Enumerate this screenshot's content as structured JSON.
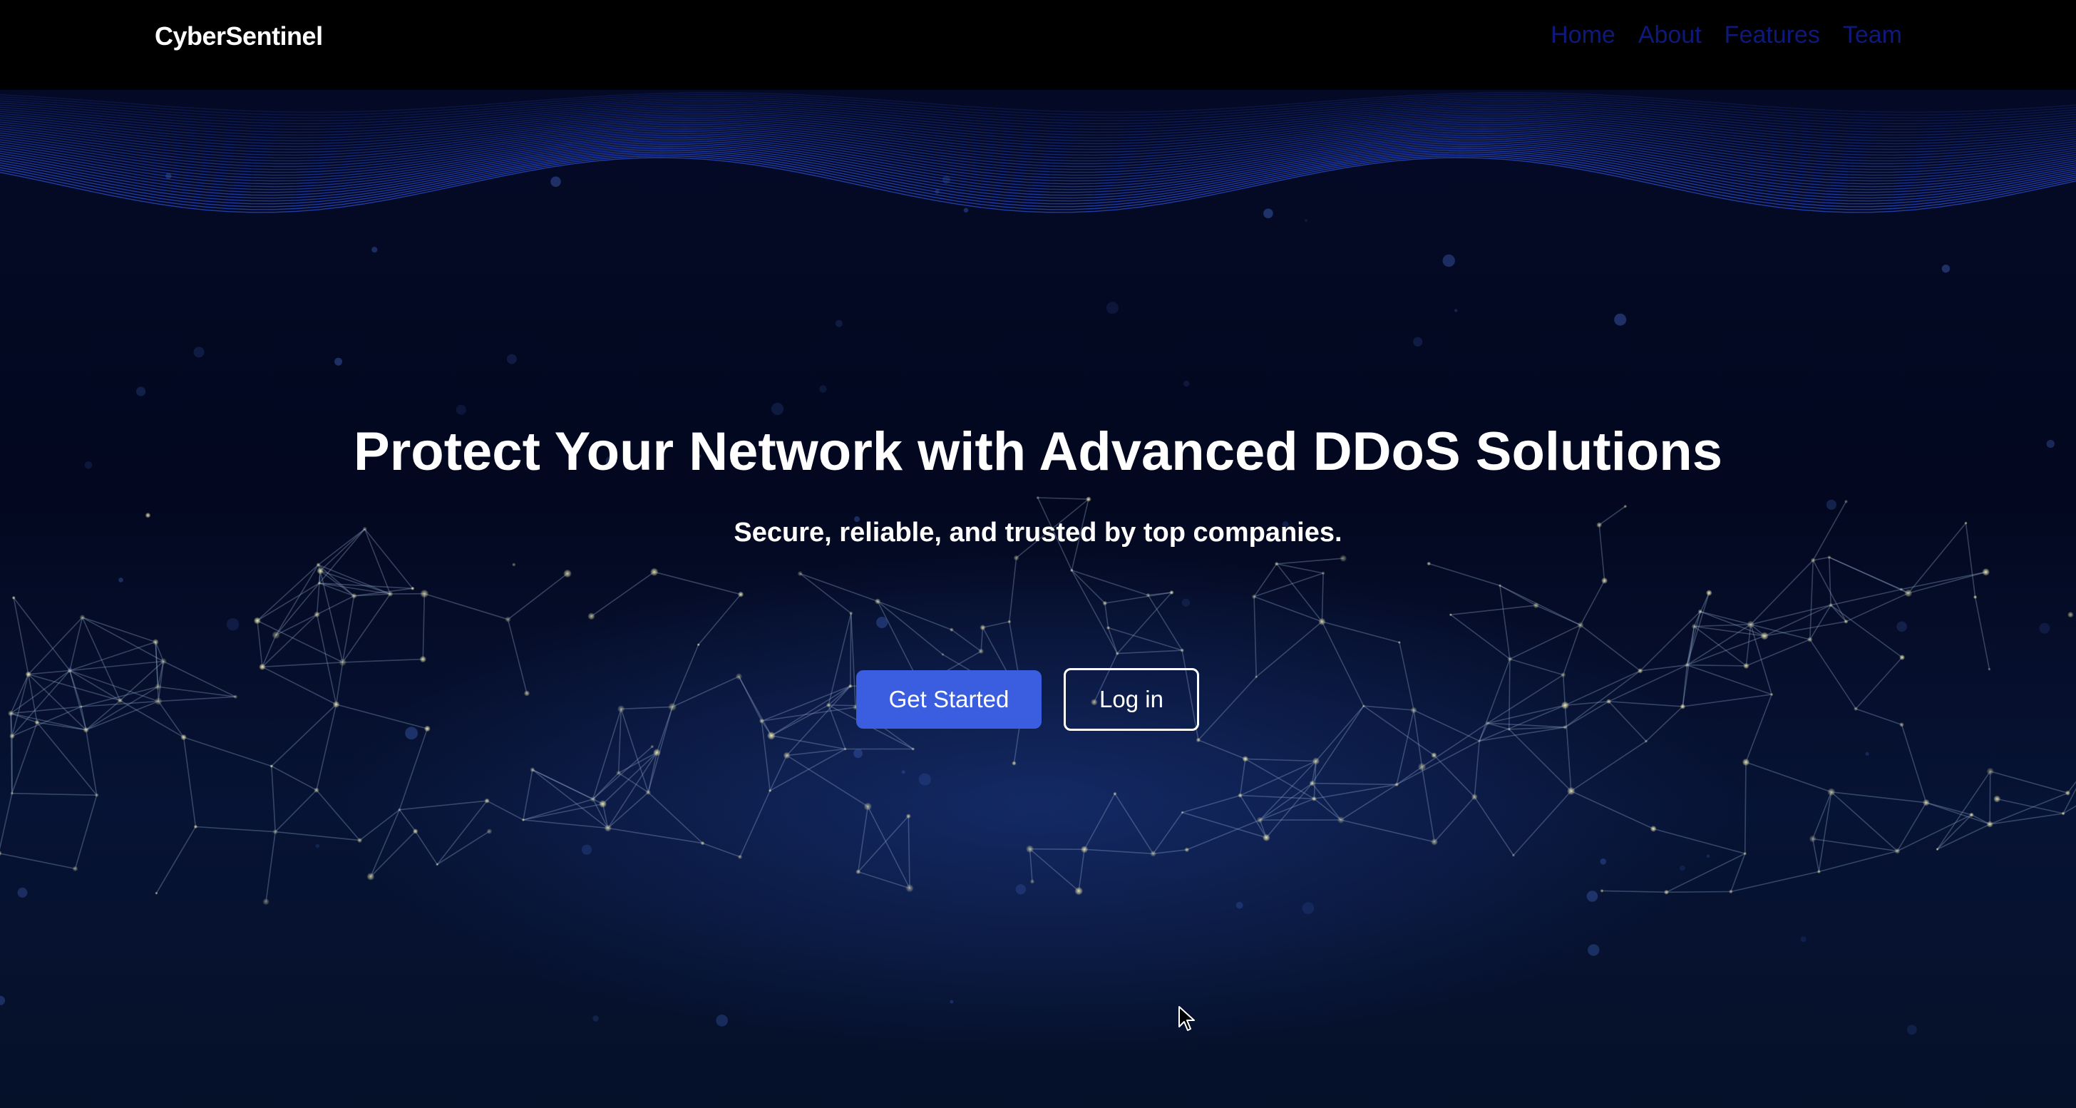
{
  "navbar": {
    "brand": "CyberSentinel",
    "links": [
      {
        "label": "Home"
      },
      {
        "label": "About"
      },
      {
        "label": "Features"
      },
      {
        "label": "Team"
      }
    ]
  },
  "hero": {
    "title": "Protect Your Network with Advanced DDoS Solutions",
    "subtitle": "Secure, reliable, and trusted by top companies.",
    "primary_button": "Get Started",
    "secondary_button": "Log in"
  },
  "colors": {
    "navbar_bg": "#000000",
    "nav_link": "#0d1a7a",
    "hero_bg": "#040a26",
    "primary_button": "#3b5ee0",
    "network_node": "#c9c89a"
  },
  "icons": {
    "cursor": "mouse-pointer-icon"
  }
}
